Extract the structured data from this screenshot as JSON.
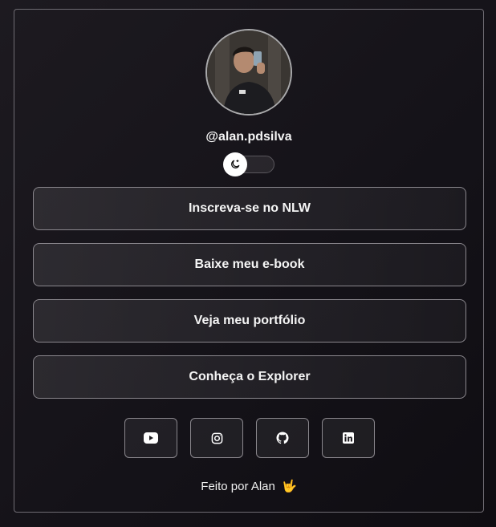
{
  "profile": {
    "handle": "@alan.pdsilva",
    "avatar_alt": "profile-photo"
  },
  "theme_toggle": {
    "icon": "moon-icon",
    "state": "dark"
  },
  "links": [
    {
      "label": "Inscreva-se no NLW"
    },
    {
      "label": "Baixe meu e-book"
    },
    {
      "label": "Veja meu portfólio"
    },
    {
      "label": "Conheça o Explorer"
    }
  ],
  "social": [
    {
      "icon": "youtube-icon"
    },
    {
      "icon": "instagram-icon"
    },
    {
      "icon": "github-icon"
    },
    {
      "icon": "linkedin-icon"
    }
  ],
  "footer": {
    "text": "Feito por Alan",
    "emoji": "🤟"
  },
  "colors": {
    "background": "#141218",
    "border": "#8a878d",
    "text": "#f5f5f5"
  }
}
